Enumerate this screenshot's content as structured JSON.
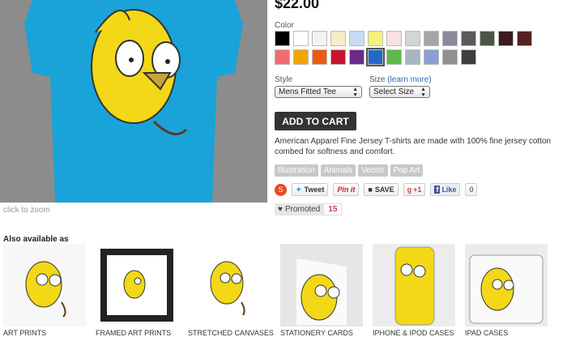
{
  "product": {
    "price": "$22.00",
    "click_to_zoom": "click to zoom",
    "color_label": "Color",
    "style_label": "Style",
    "size_label": "Size",
    "learn_more": "(learn more)",
    "style_value": "Mens Fitted Tee",
    "size_value": "Select Size",
    "add_to_cart": "ADD TO CART",
    "description": "American Apparel Fine Jersey T-shirts are made with 100% fine jersey cotton combed for softness and comfort."
  },
  "colors": [
    "#000000",
    "#ffffff",
    "#f2f2ee",
    "#f5ecc8",
    "#c7dcf3",
    "#f3f27a",
    "#f7e1e4",
    "#d4d4d4",
    "#a6a6a6",
    "#8a8a9e",
    "#5a5a5a",
    "#4e5547",
    "#3a1c1c",
    "#562020",
    "#f06d6d",
    "#f4a400",
    "#ef5a12",
    "#c4122f",
    "#6c2a8b",
    "#2368c8",
    "#5cbb47",
    "#a8b6c0",
    "#8aa0d0",
    "#909090",
    "#3e3e3e"
  ],
  "selected_color_index": 19,
  "tags": [
    "Illustration",
    "Animals",
    "Vector",
    "Pop Art"
  ],
  "social": {
    "tweet": "Tweet",
    "pinit": "Pin it",
    "save": "SAVE",
    "gplus": "+1",
    "like": "Like",
    "like_count": "0"
  },
  "promoted": {
    "label": "Promoted",
    "count": "15"
  },
  "also_available": {
    "heading": "Also available as",
    "items": [
      {
        "label": "ART PRINTS"
      },
      {
        "label": "FRAMED ART PRINTS"
      },
      {
        "label": "STRETCHED CANVASES"
      },
      {
        "label": "STATIONERY CARDS"
      },
      {
        "label": "IPHONE & IPOD CASES"
      },
      {
        "label": "IPAD CASES"
      }
    ]
  }
}
